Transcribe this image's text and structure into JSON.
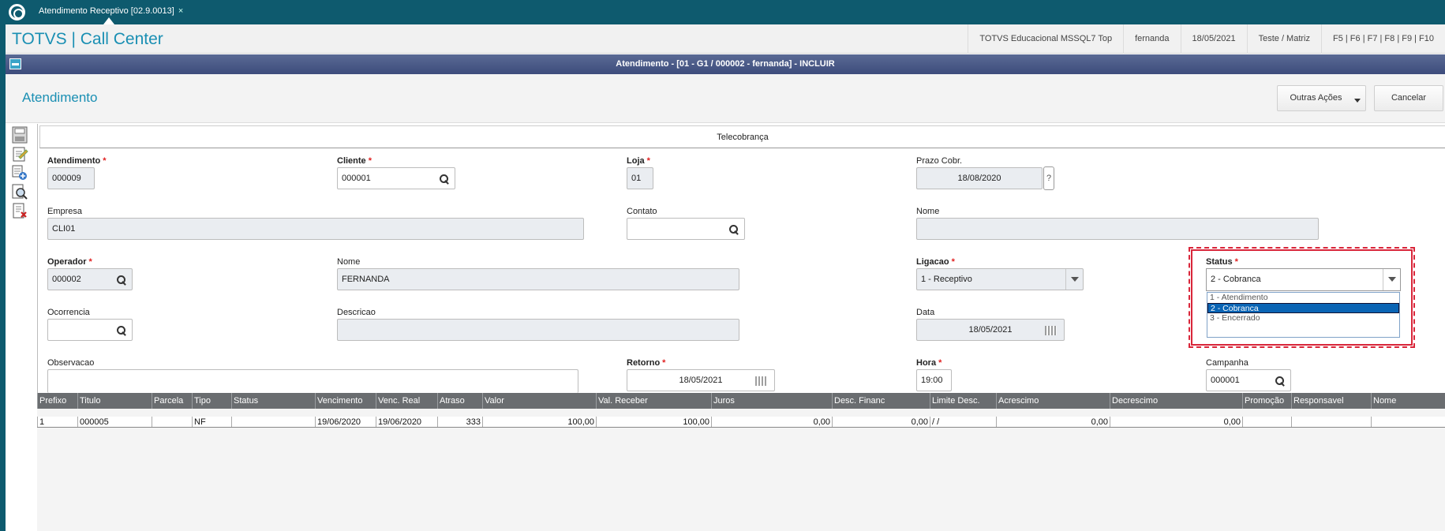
{
  "app": {
    "tab_title": "Atendimento Receptivo [02.9.0013]",
    "tab_close": "×",
    "title": "TOTVS | Call Center",
    "env": "TOTVS Educacional MSSQL7 Top",
    "user": "fernanda",
    "date": "18/05/2021",
    "branch": "Teste / Matriz",
    "shortcuts": "F5 | F6 | F7 | F8 | F9 | F10"
  },
  "dialog": {
    "title": "Atendimento - [01 - G1 / 000002 - fernanda] - INCLUIR"
  },
  "page": {
    "title": "Atendimento",
    "more_actions": "Outras Ações",
    "cancel": "Cancelar"
  },
  "folder": {
    "tab": "Telecobrança"
  },
  "form": {
    "atendimento": {
      "label": "Atendimento",
      "value": "000009"
    },
    "cliente": {
      "label": "Cliente",
      "value": "000001"
    },
    "loja": {
      "label": "Loja",
      "value": "01"
    },
    "prazo": {
      "label": "Prazo Cobr.",
      "value": "18/08/2020",
      "help": "?"
    },
    "empresa": {
      "label": "Empresa",
      "value": "CLI01"
    },
    "contato": {
      "label": "Contato",
      "value": ""
    },
    "nome_contato": {
      "label": "Nome",
      "value": ""
    },
    "operador": {
      "label": "Operador",
      "value": "000002"
    },
    "nome_operador": {
      "label": "Nome",
      "value": "FERNANDA"
    },
    "ligacao": {
      "label": "Ligacao",
      "value": "1 - Receptivo"
    },
    "status": {
      "label": "Status",
      "value": "2 - Cobranca",
      "options": [
        "1 - Atendimento",
        "2 - Cobranca",
        "3 - Encerrado"
      ],
      "selected_index": 1
    },
    "ocorrencia": {
      "label": "Ocorrencia",
      "value": ""
    },
    "descricao": {
      "label": "Descricao",
      "value": ""
    },
    "data": {
      "label": "Data",
      "value": "18/05/2021"
    },
    "observacao": {
      "label": "Observacao",
      "value": ""
    },
    "retorno": {
      "label": "Retorno",
      "value": "18/05/2021"
    },
    "hora": {
      "label": "Hora",
      "value": "19:00"
    },
    "campanha": {
      "label": "Campanha",
      "value": "000001"
    },
    "required_mark": "*"
  },
  "grid": {
    "columns": [
      "Prefixo",
      "Titulo",
      "Parcela",
      "Tipo",
      "Status",
      "Vencimento",
      "Venc. Real",
      "Atraso",
      "Valor",
      "Val. Receber",
      "Juros",
      "Desc. Financ",
      "Limite Desc.",
      "Acrescimo",
      "Decrescimo",
      "Promoção",
      "Responsavel",
      "Nome"
    ],
    "rows": [
      [
        "1",
        "000005",
        "",
        "NF",
        "",
        "19/06/2020",
        "19/06/2020",
        "333",
        "100,00",
        "100,00",
        "0,00",
        "0,00",
        " /  /",
        "0,00",
        "0,00",
        "",
        "",
        ""
      ]
    ]
  },
  "colors": {
    "topbar": "#0e5a6e",
    "accent": "#1a8fb3",
    "selected": "#0a64b4",
    "highlight": "#d9263a"
  },
  "icons": [
    "totvs-logo-icon",
    "save-icon",
    "edit-icon",
    "add-icon",
    "preview-icon",
    "delete-icon",
    "search-icon",
    "calendar-icon",
    "dropdown-arrow-icon"
  ]
}
